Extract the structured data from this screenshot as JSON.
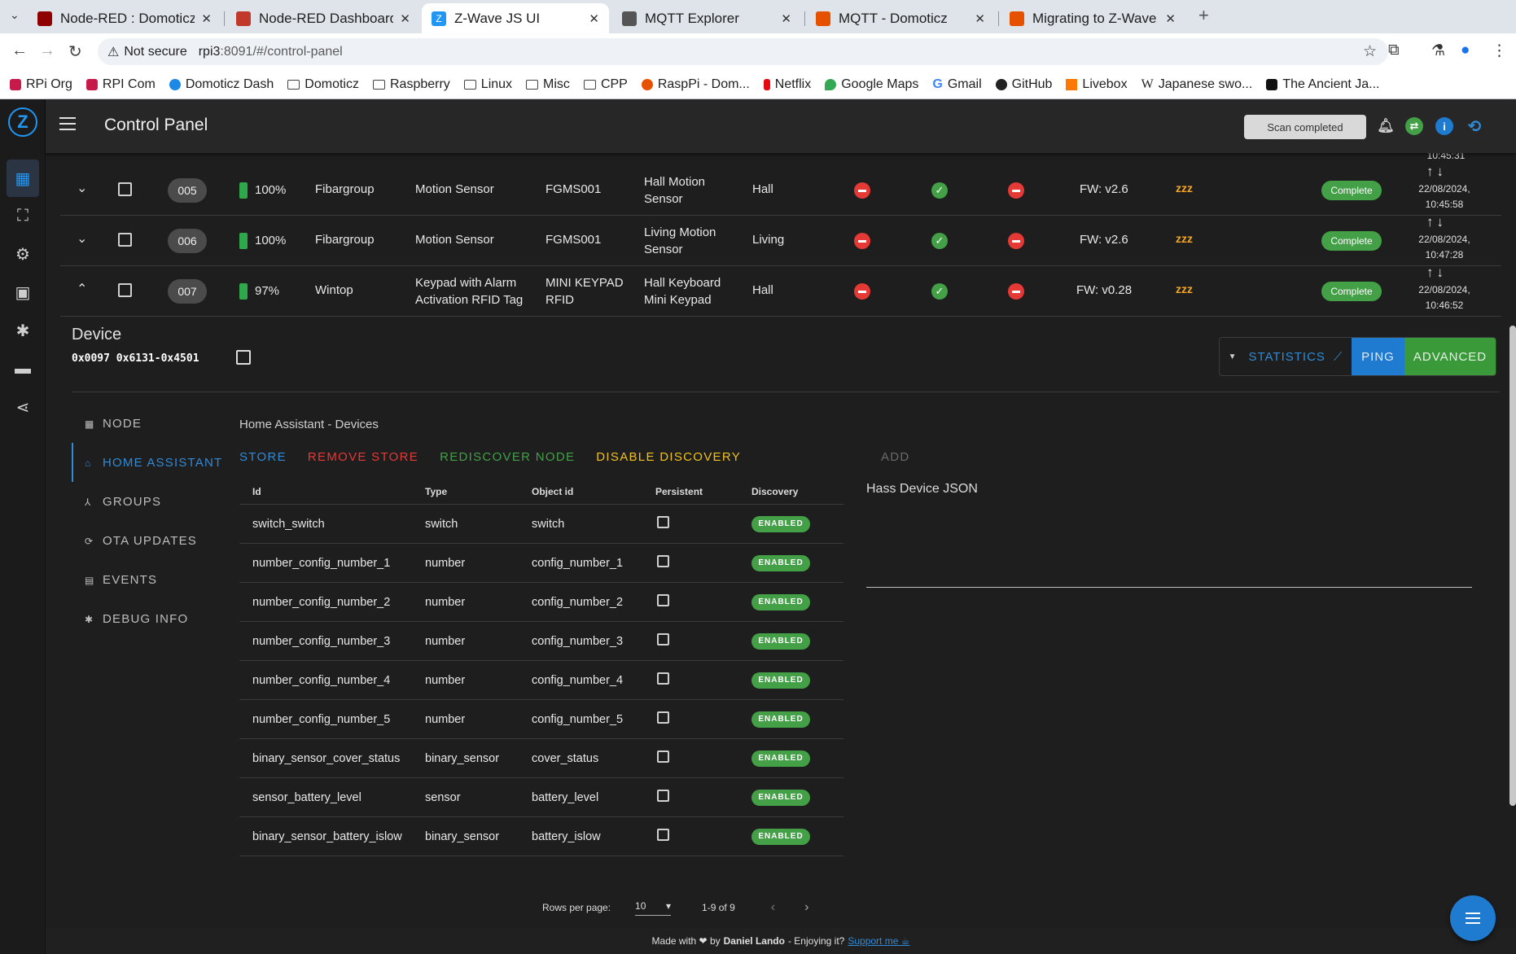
{
  "browser": {
    "tabs": [
      {
        "title": "Node-RED : Domoticz",
        "color": "#8f0000"
      },
      {
        "title": "Node-RED Dashboard",
        "color": "#c0392b"
      },
      {
        "title": "Z-Wave JS UI",
        "color": "#2196f3"
      },
      {
        "title": "MQTT Explorer",
        "color": "#555555"
      },
      {
        "title": "MQTT - Domoticz",
        "color": "#e65100"
      },
      {
        "title": "Migrating to Z-Wave JS",
        "color": "#e65100"
      }
    ],
    "not_secure": "Not secure",
    "url_host": "rpi3",
    "url_rest": ":8091/#/control-panel",
    "bookmarks": [
      {
        "label": "RPi Org",
        "kind": "icon",
        "color": "#c51a4a"
      },
      {
        "label": "RPI Com",
        "kind": "icon",
        "color": "#c51a4a"
      },
      {
        "label": "Domoticz Dash",
        "kind": "icon",
        "color": "#1e88e5"
      },
      {
        "label": "Domoticz",
        "kind": "folder"
      },
      {
        "label": "Raspberry",
        "kind": "folder"
      },
      {
        "label": "Linux",
        "kind": "folder"
      },
      {
        "label": "Misc",
        "kind": "folder"
      },
      {
        "label": "CPP",
        "kind": "folder"
      },
      {
        "label": "RaspPi - Dom...",
        "kind": "icon",
        "color": "#e65100"
      },
      {
        "label": "Netflix",
        "kind": "icon",
        "color": "#e50914"
      },
      {
        "label": "Google Maps",
        "kind": "icon",
        "color": "#34a853"
      },
      {
        "label": "Gmail",
        "kind": "icon",
        "color": "#ea4335"
      },
      {
        "label": "GitHub",
        "kind": "icon",
        "color": "#222222"
      },
      {
        "label": "Livebox",
        "kind": "icon",
        "color": "#ff7900"
      },
      {
        "label": "Japanese swo...",
        "kind": "icon",
        "color": "#444444"
      },
      {
        "label": "The Ancient Ja...",
        "kind": "icon",
        "color": "#111111"
      }
    ]
  },
  "app": {
    "logo": "Z",
    "title": "Control Panel",
    "scan_status": "Scan completed",
    "sidebar_icons": [
      "dashboard-icon",
      "qr-scan-icon",
      "settings-icon",
      "scenes-icon",
      "debug-icon",
      "folder-icon",
      "share-icon"
    ]
  },
  "nodes": [
    {
      "expand": "⌄",
      "id": "005",
      "battery": "100%",
      "manufacturer": "Fibargroup",
      "product": "Motion Sensor",
      "code": "FGMS001",
      "name1": "Hall Motion",
      "name2": "Sensor",
      "location": "Hall",
      "fw": "FW: v2.6",
      "zzz": "zzz",
      "status": "Complete",
      "ts1": "22/08/2024,",
      "ts2": "10:45:58"
    },
    {
      "expand": "⌄",
      "id": "006",
      "battery": "100%",
      "manufacturer": "Fibargroup",
      "product": "Motion Sensor",
      "code": "FGMS001",
      "name1": "Living Motion",
      "name2": "Sensor",
      "location": "Living",
      "fw": "FW: v2.6",
      "zzz": "zzz",
      "status": "Complete",
      "ts1": "22/08/2024,",
      "ts2": "10:47:28"
    },
    {
      "expand": "⌃",
      "id": "007",
      "battery": "97%",
      "manufacturer": "Wintop",
      "product": "Keypad with Alarm",
      "product2": "Activation RFID Tag",
      "code": "MINI KEYPAD",
      "code2": "RFID",
      "name1": "Hall Keyboard",
      "name2": "Mini Keypad",
      "location": "Hall",
      "fw": "FW: v0.28",
      "zzz": "zzz",
      "status": "Complete",
      "ts1": "22/08/2024,",
      "ts2": "10:46:52"
    }
  ],
  "prev_time": "10:45:31",
  "device": {
    "title": "Device",
    "ids": "0x0097 0x6131-0x4501",
    "stats_label": "STATISTICS",
    "ping_label": "PING",
    "advanced_label": "ADVANCED"
  },
  "vtabs": [
    {
      "label": "NODE",
      "icon": "▦"
    },
    {
      "label": "HOME ASSISTANT",
      "icon": "⌂"
    },
    {
      "label": "GROUPS",
      "icon": "⅄"
    },
    {
      "label": "OTA UPDATES",
      "icon": "⟳"
    },
    {
      "label": "EVENTS",
      "icon": "▤"
    },
    {
      "label": "DEBUG INFO",
      "icon": "✱"
    }
  ],
  "ha": {
    "subtitle": "Home Assistant - Devices",
    "store": "STORE",
    "remove_store": "REMOVE STORE",
    "rediscover": "REDISCOVER NODE",
    "disable": "DISABLE DISCOVERY",
    "add": "ADD",
    "json_label": "Hass Device JSON",
    "headers": {
      "id": "Id",
      "type": "Type",
      "object": "Object id",
      "persistent": "Persistent",
      "discovery": "Discovery"
    },
    "rows": [
      {
        "id": "switch_switch",
        "type": "switch",
        "object": "switch",
        "discovery": "ENABLED"
      },
      {
        "id": "number_config_number_1",
        "type": "number",
        "object": "config_number_1",
        "discovery": "ENABLED"
      },
      {
        "id": "number_config_number_2",
        "type": "number",
        "object": "config_number_2",
        "discovery": "ENABLED"
      },
      {
        "id": "number_config_number_3",
        "type": "number",
        "object": "config_number_3",
        "discovery": "ENABLED"
      },
      {
        "id": "number_config_number_4",
        "type": "number",
        "object": "config_number_4",
        "discovery": "ENABLED"
      },
      {
        "id": "number_config_number_5",
        "type": "number",
        "object": "config_number_5",
        "discovery": "ENABLED"
      },
      {
        "id": "binary_sensor_cover_status",
        "type": "binary_sensor",
        "object": "cover_status",
        "discovery": "ENABLED"
      },
      {
        "id": "sensor_battery_level",
        "type": "sensor",
        "object": "battery_level",
        "discovery": "ENABLED"
      },
      {
        "id": "binary_sensor_battery_islow",
        "type": "binary_sensor",
        "object": "battery_islow",
        "discovery": "ENABLED"
      }
    ],
    "rows_per_page_label": "Rows per page:",
    "rows_per_page": "10",
    "range": "1-9 of 9"
  },
  "footer": {
    "made_with": "Made with ❤ by",
    "author": "Daniel Lando",
    "enjoy": "- Enjoying it?",
    "support": "Support me ☕"
  }
}
